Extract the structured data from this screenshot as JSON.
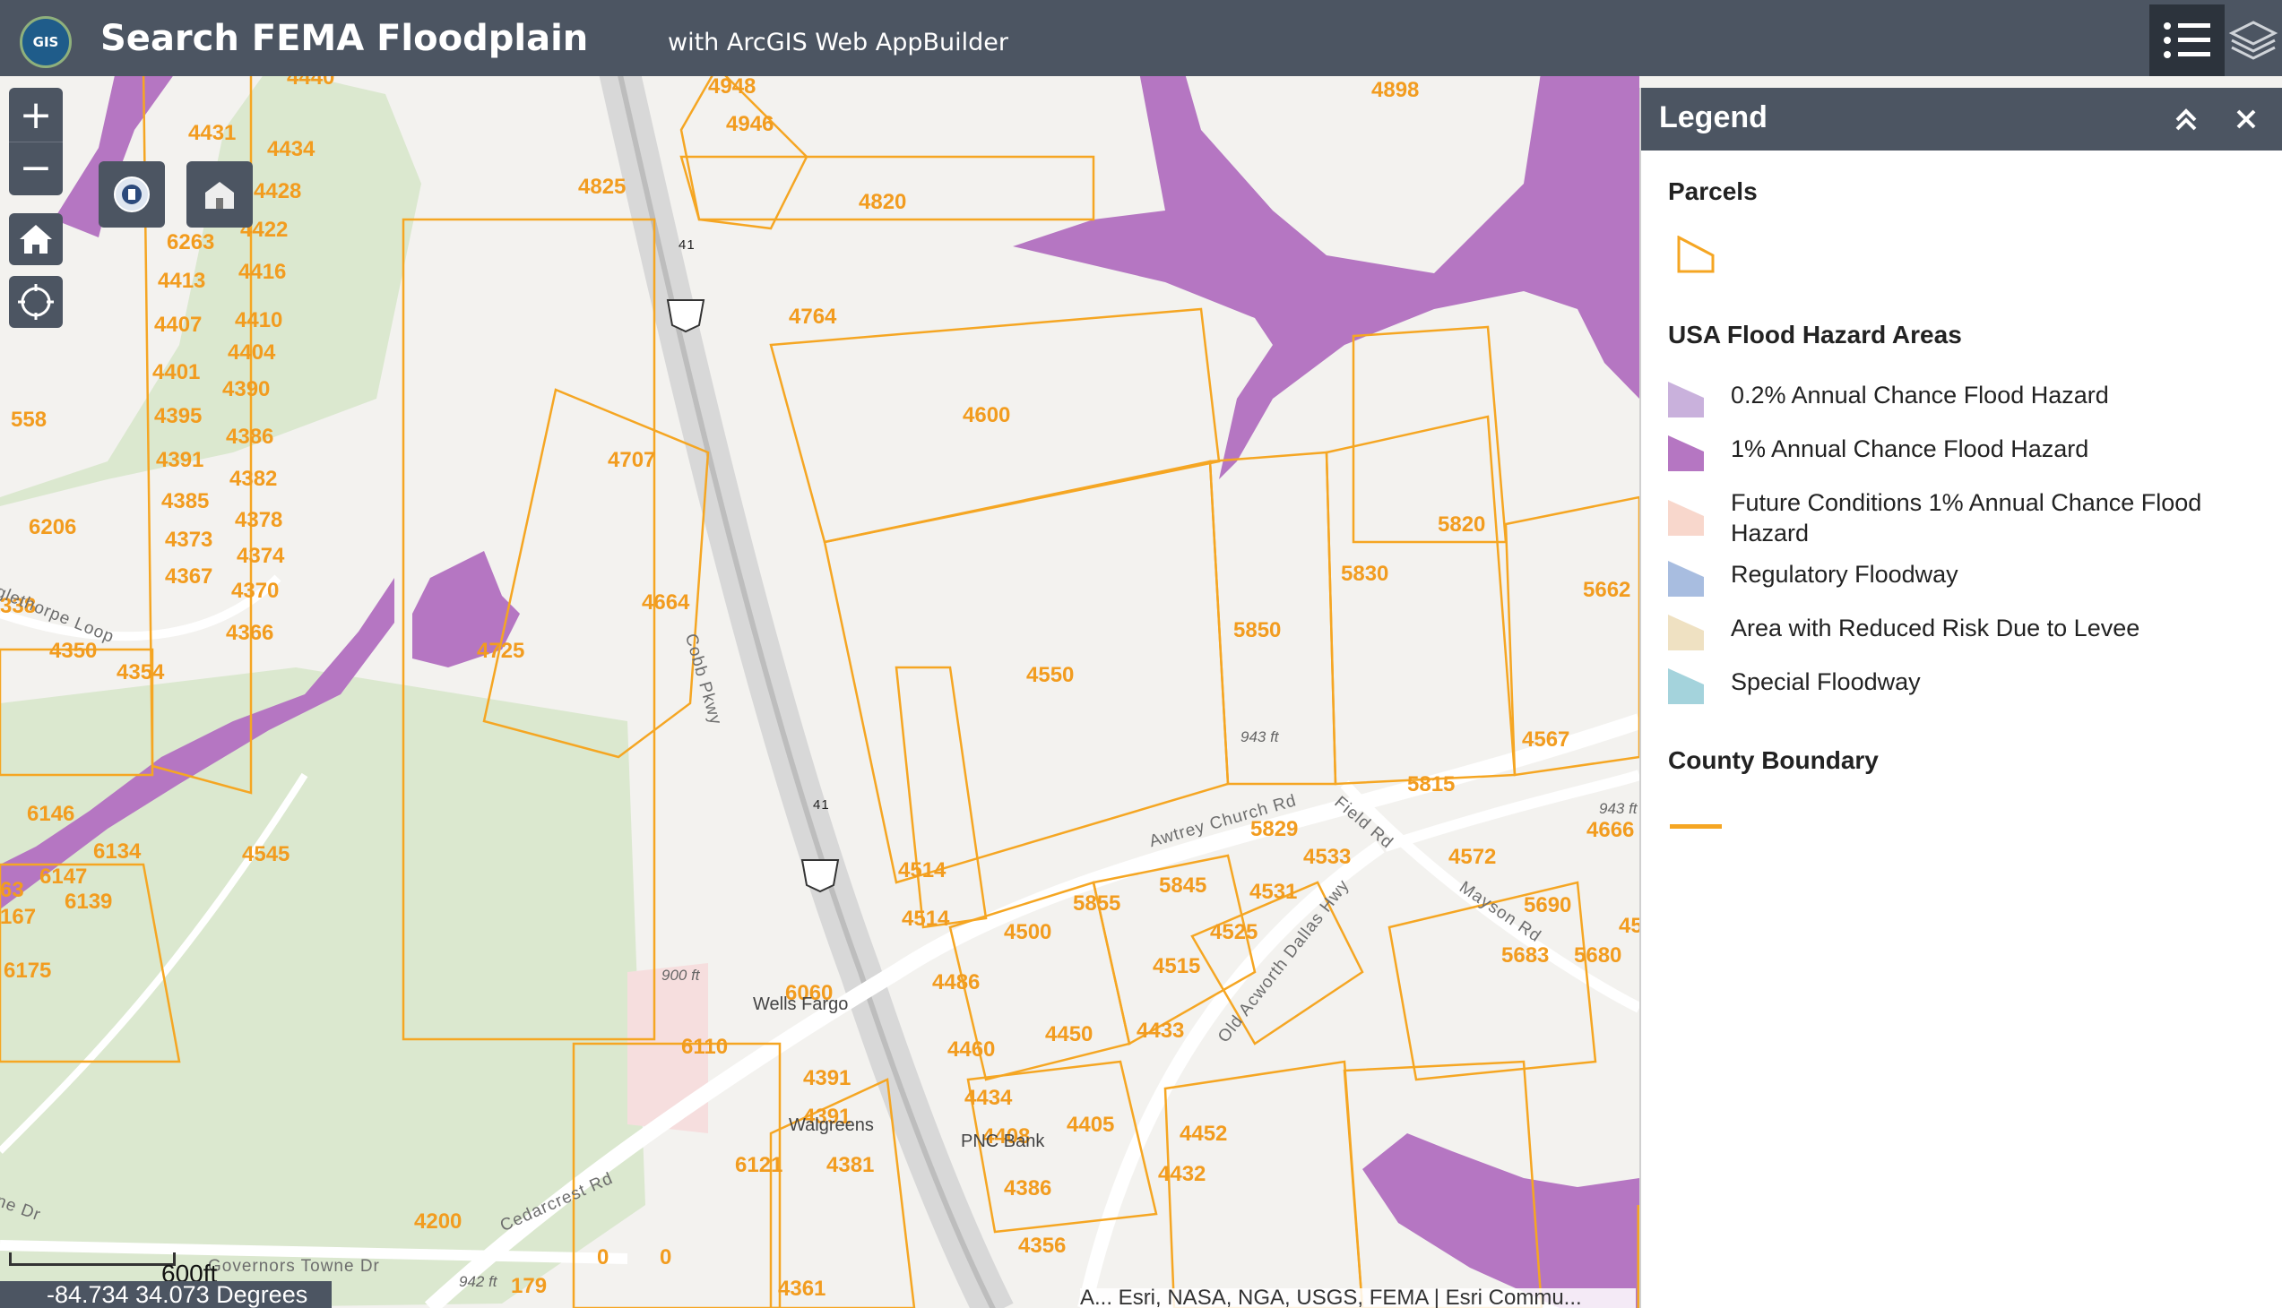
{
  "header": {
    "logo_text": "GIS",
    "title": "Search FEMA Floodplain",
    "subtitle": "with ArcGIS Web AppBuilder"
  },
  "map_controls": {
    "zoom_in": "+",
    "zoom_out": "−"
  },
  "map": {
    "parcel_labels": [
      "4440",
      "4431",
      "4434",
      "4428",
      "4422",
      "6263",
      "4416",
      "4413",
      "4410",
      "4407",
      "4404",
      "4401",
      "4390",
      "4395",
      "4386",
      "4391",
      "4382",
      "4385",
      "4378",
      "4373",
      "4374",
      "4367",
      "4370",
      "4366",
      "4350",
      "4354",
      "558",
      "6206",
      "338",
      "6146",
      "6134",
      "6147",
      "6139",
      "63",
      "167",
      "6175",
      "4545",
      "4948",
      "4946",
      "4825",
      "4820",
      "4764",
      "4707",
      "4664",
      "4725",
      "4600",
      "4550",
      "4898",
      "5820",
      "5830",
      "5850",
      "5662",
      "4567",
      "5815",
      "5829",
      "4533",
      "4572",
      "4531",
      "5845",
      "5855",
      "5690",
      "5680",
      "5683",
      "4525",
      "4515",
      "4514",
      "4514",
      "4500",
      "4486",
      "4460",
      "4450",
      "4433",
      "4434",
      "4408",
      "4405",
      "4452",
      "4432",
      "4386",
      "4356",
      "4391",
      "4391",
      "4381",
      "6121",
      "6110",
      "6060",
      "4200",
      "0",
      "0",
      "179",
      "4361",
      "4666",
      "45"
    ],
    "road_labels": [
      "Cobb Pkwy",
      "Awtrey Church Rd",
      "Field Rd",
      "Old Acworth Dallas Hwy",
      "Mayson Rd",
      "Cedarcrest Rd",
      "Governors Towne Dr",
      "glethorpe Loop",
      "ne Dr"
    ],
    "highway_shields": [
      "41",
      "41"
    ],
    "elevation_labels": [
      "943 ft",
      "900 ft",
      "943 ft",
      "942 ft"
    ],
    "poi_labels": [
      "Wells Fargo",
      "Walgreens",
      "PNC Bank"
    ]
  },
  "legend": {
    "title": "Legend",
    "sections": [
      {
        "title": "Parcels"
      },
      {
        "title": "USA Flood Hazard Areas"
      },
      {
        "title": "County Boundary"
      }
    ],
    "flood_items": [
      {
        "label": "0.2% Annual Chance Flood Hazard",
        "color": "#c9b1dc"
      },
      {
        "label": "1% Annual Chance Flood Hazard",
        "color": "#b576c2"
      },
      {
        "label": "Future Conditions 1% Annual Chance Flood Hazard",
        "color": "#f8d7cc"
      },
      {
        "label": "Regulatory Floodway",
        "color": "#a8bde0"
      },
      {
        "label": "Area with Reduced Risk Due to Levee",
        "color": "#efe1c2"
      },
      {
        "label": "Special Floodway",
        "color": "#a4d3dc"
      }
    ],
    "county_line_color": "#f5a623",
    "parcel_outline_color": "#f5a623"
  },
  "status": {
    "scale": "600ft",
    "coordinates": "-84.734 34.073 Degrees",
    "attribution": "A... Esri, NASA, NGA, USGS, FEMA | Esri Commu..."
  },
  "colors": {
    "header_bg": "#4c5562",
    "flood_1pct": "#b576c2",
    "parcel_line": "#f5a623",
    "park_green": "#dbe8cf"
  }
}
